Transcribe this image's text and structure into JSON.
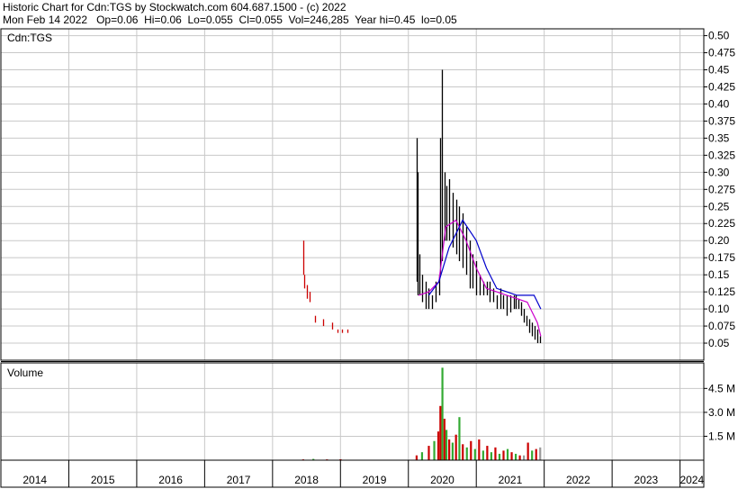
{
  "header": {
    "line1": "Historic Chart for Cdn:TGS by Stockwatch.com 604.687.1500 - (c) 2022",
    "line2": "Mon Feb 14 2022   Op=0.06  Hi=0.06  Lo=0.055  Cl=0.055  Vol=246,285  Year hi=0.45  lo=0.05"
  },
  "chart_data": [
    {
      "type": "line",
      "title": "Cdn:TGS",
      "ylim": [
        0.025,
        0.51
      ],
      "xlim": [
        2014.0,
        2024.35
      ],
      "y_ticks": [
        "0.50",
        "0.475",
        "0.45",
        "0.425",
        "0.40",
        "0.375",
        "0.35",
        "0.325",
        "0.30",
        "0.275",
        "0.25",
        "0.225",
        "0.20",
        "0.175",
        "0.15",
        "0.125",
        "0.10",
        "0.075",
        "0.05"
      ],
      "x_ticks": [
        "2014",
        "2015",
        "2016",
        "2017",
        "2018",
        "2019",
        "2020",
        "2021",
        "2022",
        "2023",
        "2024"
      ],
      "grid": true,
      "series": [
        {
          "kind": "price-bars",
          "color": "#000000",
          "down_color": "#cc0000",
          "x": [
            2018.45,
            2018.47,
            2018.5,
            2018.55,
            2018.62,
            2018.75,
            2018.88,
            2018.95,
            2019.02,
            2019.1,
            2020.12,
            2020.14,
            2020.16,
            2020.2,
            2020.25,
            2020.3,
            2020.35,
            2020.4,
            2020.45,
            2020.47,
            2020.5,
            2020.53,
            2020.56,
            2020.6,
            2020.65,
            2020.7,
            2020.75,
            2020.8,
            2020.85,
            2020.9,
            2020.95,
            2021.0,
            2021.05,
            2021.1,
            2021.15,
            2021.2,
            2021.25,
            2021.3,
            2021.35,
            2021.4,
            2021.45,
            2021.5,
            2021.55,
            2021.58,
            2021.62,
            2021.66,
            2021.7,
            2021.74,
            2021.78,
            2021.82,
            2021.86,
            2021.9,
            2021.94
          ],
          "high": [
            0.2,
            0.15,
            0.135,
            0.125,
            0.09,
            0.085,
            0.08,
            0.07,
            0.07,
            0.07,
            0.35,
            0.3,
            0.18,
            0.15,
            0.14,
            0.13,
            0.12,
            0.14,
            0.15,
            0.35,
            0.45,
            0.3,
            0.28,
            0.29,
            0.27,
            0.26,
            0.25,
            0.24,
            0.22,
            0.2,
            0.18,
            0.17,
            0.15,
            0.14,
            0.14,
            0.14,
            0.13,
            0.12,
            0.13,
            0.12,
            0.12,
            0.12,
            0.12,
            0.12,
            0.115,
            0.11,
            0.1,
            0.09,
            0.085,
            0.08,
            0.075,
            0.07,
            0.06
          ],
          "low": [
            0.15,
            0.13,
            0.115,
            0.11,
            0.08,
            0.075,
            0.07,
            0.065,
            0.065,
            0.065,
            0.14,
            0.12,
            0.12,
            0.11,
            0.1,
            0.1,
            0.1,
            0.11,
            0.12,
            0.15,
            0.17,
            0.2,
            0.2,
            0.2,
            0.19,
            0.18,
            0.17,
            0.16,
            0.15,
            0.13,
            0.13,
            0.12,
            0.12,
            0.12,
            0.12,
            0.11,
            0.11,
            0.1,
            0.1,
            0.1,
            0.09,
            0.095,
            0.1,
            0.1,
            0.1,
            0.09,
            0.08,
            0.075,
            0.065,
            0.06,
            0.055,
            0.05,
            0.05
          ]
        },
        {
          "kind": "moving-average",
          "color": "#cc00cc",
          "x": [
            2020.15,
            2020.3,
            2020.45,
            2020.55,
            2020.7,
            2020.85,
            2021.0,
            2021.15,
            2021.3,
            2021.45,
            2021.6,
            2021.75,
            2021.9,
            2021.95
          ],
          "values": [
            0.12,
            0.125,
            0.14,
            0.22,
            0.23,
            0.2,
            0.16,
            0.13,
            0.125,
            0.12,
            0.115,
            0.11,
            0.08,
            0.06
          ]
        },
        {
          "kind": "moving-average",
          "color": "#0000cc",
          "x": [
            2020.3,
            2020.45,
            2020.6,
            2020.8,
            2021.0,
            2021.15,
            2021.3,
            2021.45,
            2021.6,
            2021.75,
            2021.85,
            2021.95
          ],
          "values": [
            0.12,
            0.14,
            0.19,
            0.23,
            0.2,
            0.16,
            0.13,
            0.125,
            0.12,
            0.12,
            0.12,
            0.1
          ]
        }
      ]
    },
    {
      "type": "bar",
      "title": "Volume",
      "ylim": [
        0,
        6.1
      ],
      "y_ticks": [
        "4.5 M",
        "3.0 M",
        "1.5 M"
      ],
      "y_tick_values": [
        4.5,
        3.0,
        1.5
      ],
      "y_unit": "M",
      "up_color": "#33aa33",
      "down_color": "#cc0000",
      "gray_color": "#999999",
      "x": [
        2018.45,
        2018.6,
        2018.8,
        2019.0,
        2020.12,
        2020.2,
        2020.3,
        2020.38,
        2020.44,
        2020.47,
        2020.5,
        2020.53,
        2020.56,
        2020.6,
        2020.65,
        2020.7,
        2020.75,
        2020.8,
        2020.86,
        2020.92,
        2020.98,
        2021.04,
        2021.1,
        2021.16,
        2021.22,
        2021.28,
        2021.34,
        2021.4,
        2021.46,
        2021.52,
        2021.58,
        2021.64,
        2021.7,
        2021.76,
        2021.82,
        2021.88,
        2021.94
      ],
      "values": [
        0.05,
        0.08,
        0.05,
        0.06,
        0.3,
        0.5,
        0.9,
        1.2,
        1.8,
        3.4,
        5.8,
        2.6,
        1.9,
        1.3,
        1.1,
        1.6,
        2.7,
        1.0,
        0.8,
        1.2,
        0.7,
        1.3,
        0.6,
        0.9,
        0.5,
        0.8,
        0.4,
        0.6,
        0.7,
        0.5,
        0.4,
        0.3,
        0.3,
        1.1,
        0.6,
        0.7,
        0.8
      ],
      "direction": [
        "down",
        "up",
        "down",
        "down",
        "down",
        "up",
        "down",
        "up",
        "down",
        "down",
        "up",
        "down",
        "up",
        "down",
        "up",
        "down",
        "up",
        "down",
        "up",
        "down",
        "up",
        "down",
        "up",
        "down",
        "up",
        "down",
        "up",
        "down",
        "up",
        "down",
        "up",
        "down",
        "gray",
        "down",
        "up",
        "down",
        "gray"
      ]
    }
  ]
}
